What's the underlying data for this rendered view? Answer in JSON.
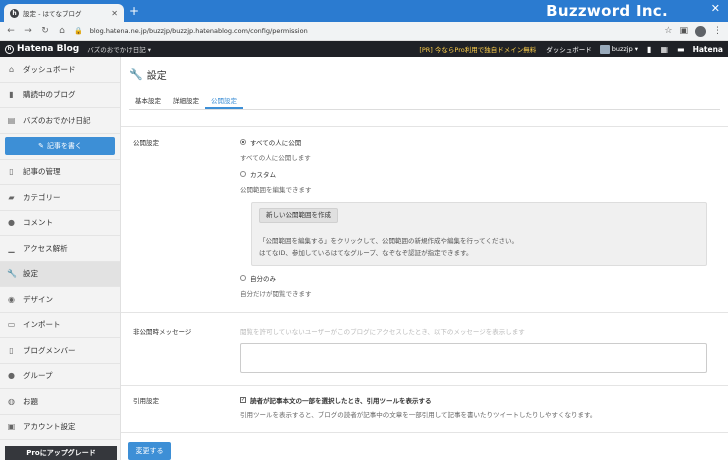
{
  "browser": {
    "tab_title": "設定 - はてなブログ",
    "tab_favicon_letter": "h",
    "url": "blog.hatena.ne.jp/buzzjp/buzzjp.hatenablog.com/config/permission",
    "watermark": "Buzzword Inc."
  },
  "globalbar": {
    "logo_text": "Hatena Blog",
    "blog_select": "バズのおでかけ日記 ▾",
    "promo": "[PR] 今ならPro利用で独自ドメイン無料",
    "dashboard": "ダッシュボード",
    "user": "buzzjp ▾",
    "hatena": "Hatena"
  },
  "sidebar": {
    "items_top": [
      {
        "label": "ダッシュボード",
        "icon": "home-icon"
      },
      {
        "label": "購読中のブログ",
        "icon": "bookmark-icon"
      },
      {
        "label": "バズのおでかけ日記",
        "icon": "blog-icon"
      }
    ],
    "write_button": "記事を書く",
    "items": [
      {
        "label": "記事の管理",
        "icon": "document-icon"
      },
      {
        "label": "カテゴリー",
        "icon": "folder-icon"
      },
      {
        "label": "コメント",
        "icon": "comment-icon"
      },
      {
        "label": "アクセス解析",
        "icon": "chart-icon"
      },
      {
        "label": "設定",
        "icon": "wrench-icon",
        "active": true
      },
      {
        "label": "デザイン",
        "icon": "palette-icon"
      },
      {
        "label": "インポート",
        "icon": "import-icon"
      },
      {
        "label": "ブログメンバー",
        "icon": "members-icon"
      },
      {
        "label": "グループ",
        "icon": "group-icon"
      },
      {
        "label": "お題",
        "icon": "theme-icon"
      },
      {
        "label": "アカウント設定",
        "icon": "account-icon"
      }
    ],
    "upgrade": "Proにアップグレード"
  },
  "main": {
    "title": "設定",
    "tabs": [
      "基本設定",
      "詳細設定",
      "公開設定"
    ],
    "active_tab": "公開設定",
    "publish": {
      "label": "公開設定",
      "options": [
        {
          "label": "すべての人に公開",
          "hint": "すべての人に公開します",
          "selected": true
        },
        {
          "label": "カスタム",
          "hint": "公開範囲を編集できます",
          "selected": false
        },
        {
          "label": "自分のみ",
          "hint": "自分だけが閲覧できます",
          "selected": false
        }
      ],
      "new_range_button": "新しい公開範囲を作成",
      "box_line1": "「公開範囲を編集する」をクリックして、公開範囲の新規作成や編集を行ってください。",
      "box_line2": "はてなID、参加しているはてなグループ、なぞなぞ認証が指定できます。"
    },
    "private_message": {
      "label": "非公開時メッセージ",
      "placeholder": "閲覧を許可していないユーザーがこのブログにアクセスしたとき、以下のメッセージを表示します",
      "value": ""
    },
    "quote": {
      "label": "引用設定",
      "checkbox_label": "読者が記事本文の一部を選択したとき、引用ツールを表示する",
      "checked": true,
      "hint": "引用ツールを表示すると、ブログの読者が記事中の文章を一部引用して記事を書いたりツイートしたりしやすくなります。"
    },
    "submit": "変更する"
  }
}
